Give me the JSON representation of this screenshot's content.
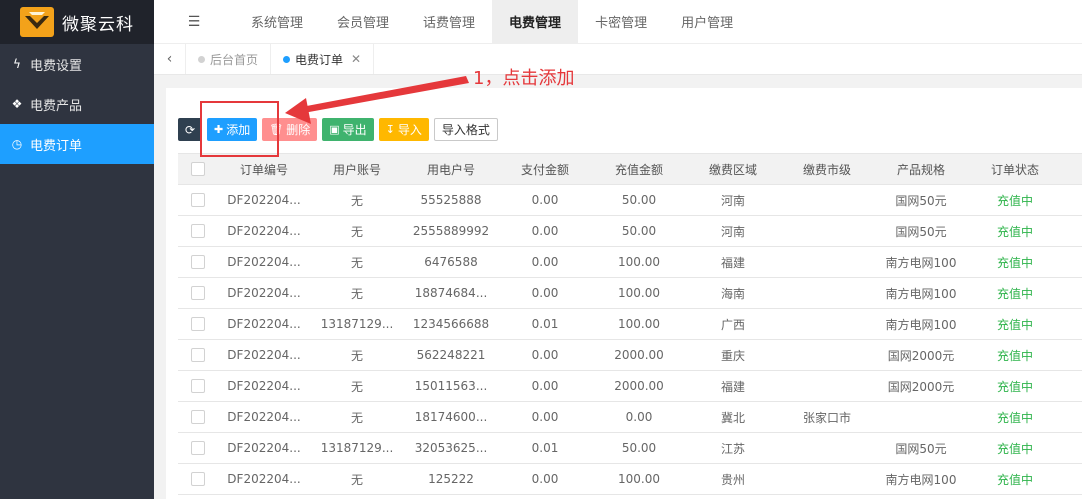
{
  "app": {
    "name": "微聚云科"
  },
  "sidebar": {
    "items": [
      {
        "label": "电费设置",
        "icon": "bolt-icon"
      },
      {
        "label": "电费产品",
        "icon": "cubes-icon"
      },
      {
        "label": "电费订单",
        "icon": "clock-icon",
        "active": true
      }
    ]
  },
  "topnav": {
    "items": [
      {
        "label": "系统管理"
      },
      {
        "label": "会员管理"
      },
      {
        "label": "话费管理"
      },
      {
        "label": "电费管理",
        "active": true
      },
      {
        "label": "卡密管理"
      },
      {
        "label": "用户管理"
      }
    ]
  },
  "tabs": [
    {
      "label": "后台首页"
    },
    {
      "label": "电费订单",
      "active": true
    }
  ],
  "toolbar": {
    "refresh_icon": "refresh-icon",
    "add_label": "添加",
    "delete_label": "删除",
    "export_label": "导出",
    "import_label": "导入",
    "import_format_label": "导入格式"
  },
  "table": {
    "columns": [
      "订单编号",
      "用户账号",
      "用电户号",
      "支付金额",
      "充值金额",
      "缴费区域",
      "缴费市级",
      "产品规格",
      "订单状态"
    ],
    "rows": [
      [
        "DF202204...",
        "无",
        "55525888",
        "0.00",
        "50.00",
        "河南",
        "",
        "国网50元",
        "充值中"
      ],
      [
        "DF202204...",
        "无",
        "2555889992",
        "0.00",
        "50.00",
        "河南",
        "",
        "国网50元",
        "充值中"
      ],
      [
        "DF202204...",
        "无",
        "6476588",
        "0.00",
        "100.00",
        "福建",
        "",
        "南方电网100",
        "充值中"
      ],
      [
        "DF202204...",
        "无",
        "18874684...",
        "0.00",
        "100.00",
        "海南",
        "",
        "南方电网100",
        "充值中"
      ],
      [
        "DF202204...",
        "13187129...",
        "1234566688",
        "0.01",
        "100.00",
        "广西",
        "",
        "南方电网100",
        "充值中"
      ],
      [
        "DF202204...",
        "无",
        "562248221",
        "0.00",
        "2000.00",
        "重庆",
        "",
        "国网2000元",
        "充值中"
      ],
      [
        "DF202204...",
        "无",
        "15011563...",
        "0.00",
        "2000.00",
        "福建",
        "",
        "国网2000元",
        "充值中"
      ],
      [
        "DF202204...",
        "无",
        "18174600...",
        "0.00",
        "0.00",
        "冀北",
        "张家口市",
        "",
        "充值中"
      ],
      [
        "DF202204...",
        "13187129...",
        "32053625...",
        "0.01",
        "50.00",
        "江苏",
        "",
        "国网50元",
        "充值中"
      ],
      [
        "DF202204...",
        "无",
        "125222",
        "0.00",
        "100.00",
        "贵州",
        "",
        "南方电网100",
        "充值中"
      ]
    ]
  },
  "annotation": {
    "text": "1，点击添加",
    "color": "#e5383b"
  }
}
